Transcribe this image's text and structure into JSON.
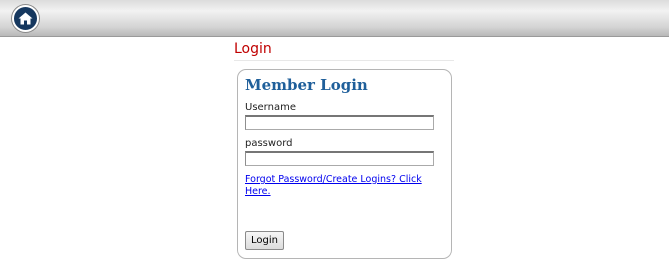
{
  "header": {
    "home_icon": "home-icon"
  },
  "page": {
    "title": "Login"
  },
  "login_form": {
    "heading": "Member Login",
    "username_label": "Username",
    "username_value": "",
    "password_label": "password",
    "password_value": "",
    "forgot_link": "Forgot Password/Create Logins? Click Here.",
    "submit_label": "Login"
  },
  "colors": {
    "title": "#c00000",
    "heading": "#1f5f9a",
    "link": "#0000ee",
    "home_button": "#16385f"
  }
}
